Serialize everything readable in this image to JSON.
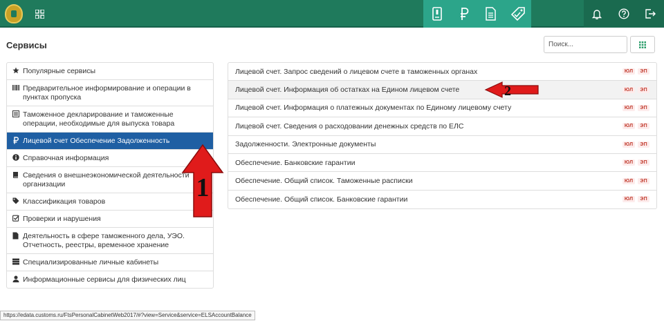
{
  "header": {
    "logo_icon": "eagle-emblem-icon",
    "apps_icon": "grid-icon",
    "tools": [
      "passport-icon",
      "ruble-icon",
      "document-icon",
      "tag-check-icon"
    ],
    "right_tools": [
      "bell-icon",
      "help-icon",
      "logout-icon"
    ],
    "colors": {
      "bar": "#1f7a5c",
      "tools_bg": "#2ca58a",
      "right_bg": "#1a6a4f"
    }
  },
  "page": {
    "title": "Сервисы",
    "search_placeholder": "Поиск..."
  },
  "sidebar": {
    "items": [
      {
        "icon": "star-icon",
        "label": "Популярные сервисы"
      },
      {
        "icon": "barcode-icon",
        "label": "Предварительное информирование и операции в пунктах пропуска"
      },
      {
        "icon": "declaration-icon",
        "label": "Таможенное декларирование и таможенные операции, необходимые для выпуска товара"
      },
      {
        "icon": "ruble-icon",
        "label": "Лицевой счет Обеспечение Задолженность",
        "active": true
      },
      {
        "icon": "info-icon",
        "label": "Справочная информация"
      },
      {
        "icon": "book-icon",
        "label": "Сведения о внешнеэкономической деятельности организации"
      },
      {
        "icon": "tag-icon",
        "label": "Классификация товаров"
      },
      {
        "icon": "checkbox-icon",
        "label": "Проверки и нарушения"
      },
      {
        "icon": "file-icon",
        "label": "Деятельность в сфере таможенного дела, УЭО. Отчетность, реестры, временное хранение"
      },
      {
        "icon": "server-icon",
        "label": "Специализированные личные кабинеты"
      },
      {
        "icon": "user-icon",
        "label": "Информационные сервисы для физических лиц"
      }
    ],
    "active_color": "#1f5fa3"
  },
  "services": {
    "badge_ul": "ЮЛ",
    "badge_ep": "ЭП",
    "rows": [
      "Лицевой счет. Запрос сведений о лицевом счете в таможенных органах",
      "Лицевой счет. Информация об остатках на Едином лицевом счете",
      "Лицевой счет. Информация о платежных документах по Единому лицевому счету",
      "Лицевой счет. Сведения о расходовании денежных средств по ЕЛС",
      "Задолженности. Электронные документы",
      "Обеспечение. Банковские гарантии",
      "Обеспечение. Общий список. Таможенные расписки",
      "Обеспечение. Общий список. Банковские гарантии"
    ],
    "highlighted_index": 1,
    "badge_color": "#c0392b"
  },
  "status_url": "https://edata.customs.ru/FtsPersonalCabinetWeb2017/#?view=Service&service=ELSAccountBalance",
  "annotations": {
    "arrow1_label": "1",
    "arrow2_label": "2",
    "arrow_color": "#e01b1b"
  }
}
